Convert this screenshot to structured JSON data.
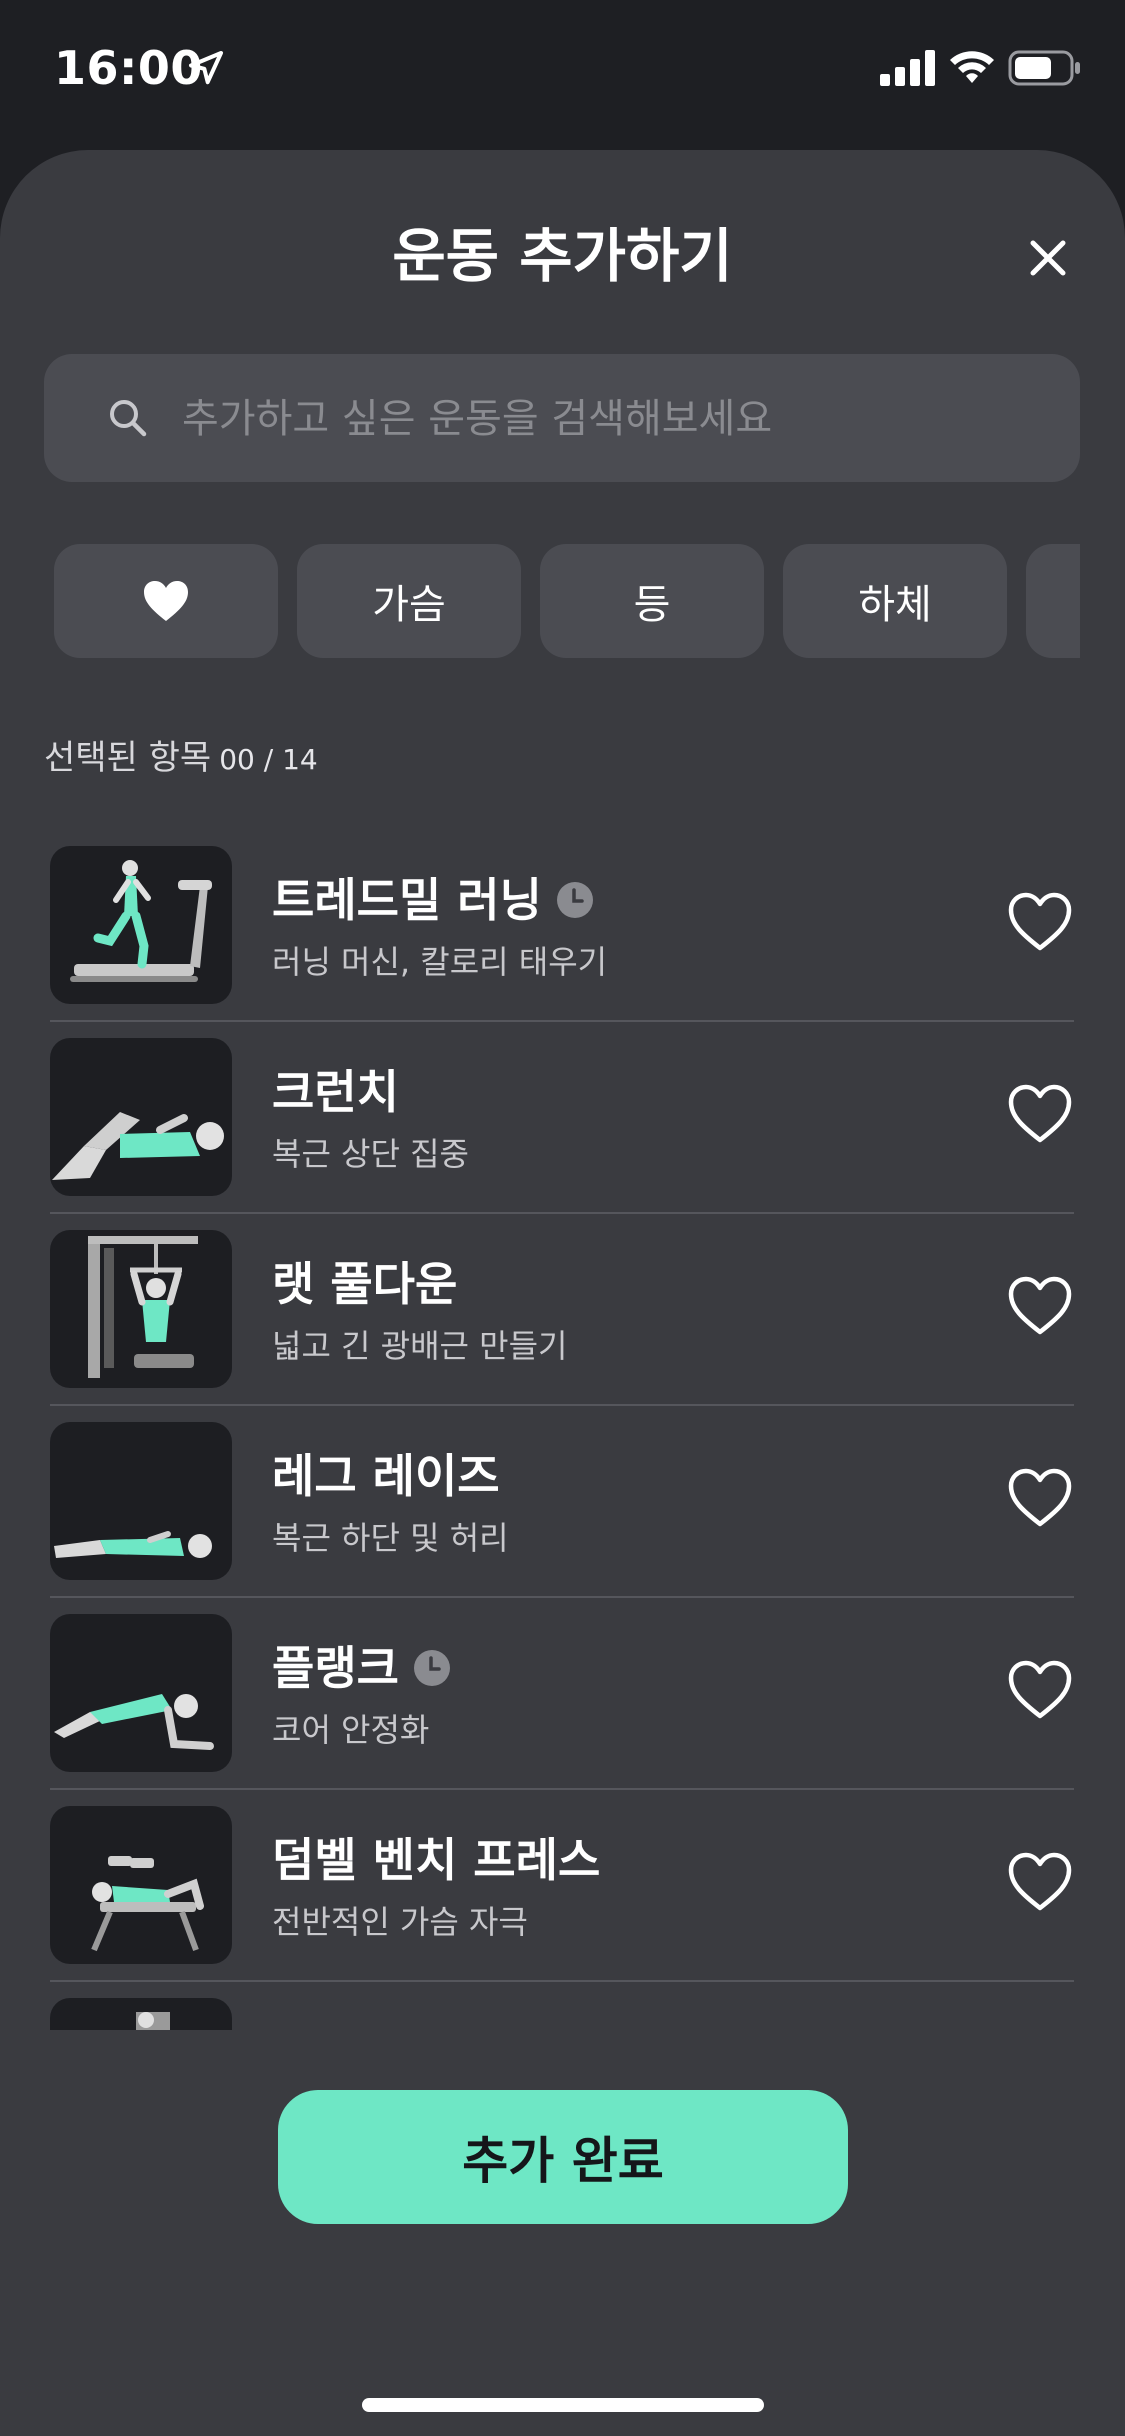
{
  "status_bar": {
    "time": "16:00"
  },
  "sheet": {
    "title": "운동 추가하기"
  },
  "search": {
    "placeholder": "추가하고 싶은 운동을 검색해보세요",
    "value": ""
  },
  "categories": [
    {
      "icon": "heart-icon",
      "label": ""
    },
    {
      "label": "가슴"
    },
    {
      "label": "등"
    },
    {
      "label": "하체"
    }
  ],
  "selection": {
    "label": "선택된 항목",
    "count": "00 / 14"
  },
  "exercises": [
    {
      "title": "트레드밀 러닝",
      "subtitle": "러닝 머신, 칼로리 태우기",
      "timed": true
    },
    {
      "title": "크런치",
      "subtitle": "복근 상단 집중",
      "timed": false
    },
    {
      "title": "랫 풀다운",
      "subtitle": "넓고 긴 광배근 만들기",
      "timed": false
    },
    {
      "title": "레그 레이즈",
      "subtitle": "복근 하단 및 허리",
      "timed": false
    },
    {
      "title": "플랭크",
      "subtitle": "코어 안정화",
      "timed": true
    },
    {
      "title": "덤벨 벤치 프레스",
      "subtitle": "전반적인 가슴 자극",
      "timed": false
    }
  ],
  "actions": {
    "complete_label": "추가 완료"
  },
  "colors": {
    "background": "#1e1f23",
    "sheet": "#3a3b40",
    "field": "#4b4c52",
    "accent": "#6ee7c5"
  }
}
